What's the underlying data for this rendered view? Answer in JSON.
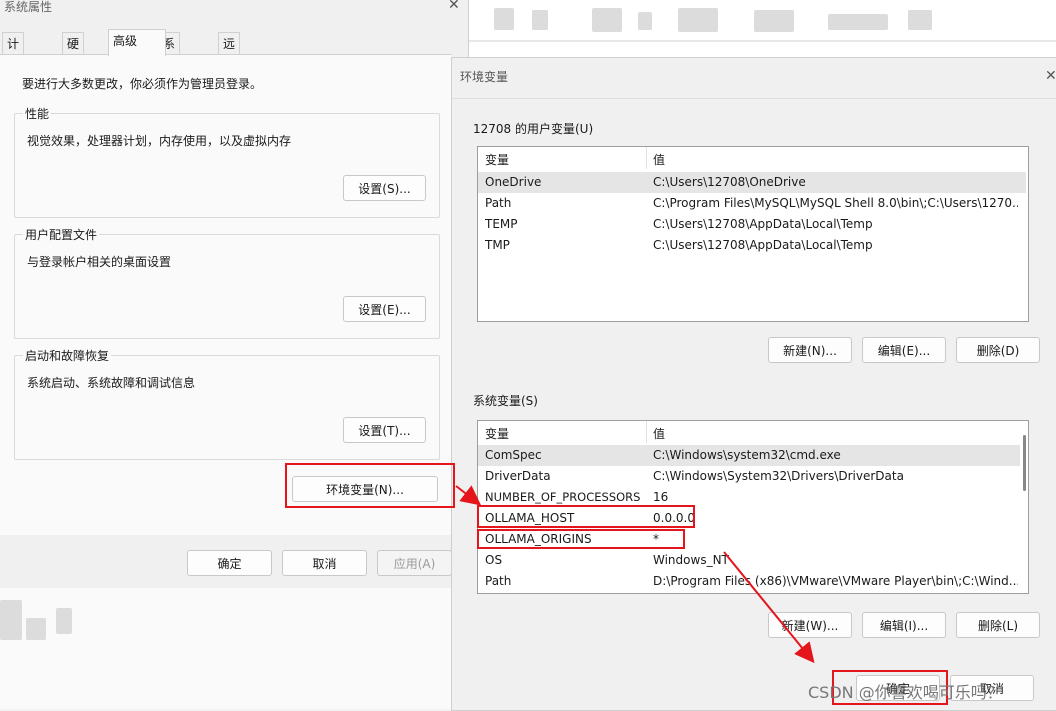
{
  "system_properties": {
    "title": "系统属性",
    "tabs": [
      "计算机名",
      "硬件",
      "高级",
      "系统保护",
      "远程"
    ],
    "active_tab": "高级",
    "admin_note": "要进行大多数更改，你必须作为管理员登录。",
    "performance": {
      "title": "性能",
      "desc": "视觉效果，处理器计划，内存使用，以及虚拟内存",
      "button": "设置(S)..."
    },
    "user_profiles": {
      "title": "用户配置文件",
      "desc": "与登录帐户相关的桌面设置",
      "button": "设置(E)..."
    },
    "startup_recovery": {
      "title": "启动和故障恢复",
      "desc": "系统启动、系统故障和调试信息",
      "button": "设置(T)..."
    },
    "env_button": "环境变量(N)...",
    "ok": "确定",
    "cancel": "取消",
    "apply": "应用(A)"
  },
  "env_dialog": {
    "title": "环境变量",
    "user_vars": {
      "label": "12708 的用户变量(U)",
      "col_name": "变量",
      "col_value": "值",
      "rows": [
        {
          "name": "OneDrive",
          "value": "C:\\Users\\12708\\OneDrive",
          "selected": true
        },
        {
          "name": "Path",
          "value": "C:\\Program Files\\MySQL\\MySQL Shell 8.0\\bin\\;C:\\Users\\1270..."
        },
        {
          "name": "TEMP",
          "value": "C:\\Users\\12708\\AppData\\Local\\Temp"
        },
        {
          "name": "TMP",
          "value": "C:\\Users\\12708\\AppData\\Local\\Temp"
        }
      ],
      "buttons": {
        "new": "新建(N)...",
        "edit": "编辑(E)...",
        "delete": "删除(D)"
      }
    },
    "system_vars": {
      "label": "系统变量(S)",
      "col_name": "变量",
      "col_value": "值",
      "rows": [
        {
          "name": "ComSpec",
          "value": "C:\\Windows\\system32\\cmd.exe",
          "selected": true
        },
        {
          "name": "DriverData",
          "value": "C:\\Windows\\System32\\Drivers\\DriverData"
        },
        {
          "name": "NUMBER_OF_PROCESSORS",
          "value": "16"
        },
        {
          "name": "OLLAMA_HOST",
          "value": "0.0.0.0"
        },
        {
          "name": "OLLAMA_ORIGINS",
          "value": "*"
        },
        {
          "name": "OS",
          "value": "Windows_NT"
        },
        {
          "name": "Path",
          "value": "D:\\Program Files (x86)\\VMware\\VMware Player\\bin\\;C:\\Wind..."
        }
      ],
      "buttons": {
        "new": "新建(W)...",
        "edit": "编辑(I)...",
        "delete": "删除(L)"
      }
    },
    "ok": "确定",
    "cancel": "取消"
  },
  "watermark": "CSDN @你喜欢喝可乐吗？",
  "colors": {
    "annotation_red": "#e5161b",
    "selection": "#e5e5e5",
    "dialog_bg": "#f0f0f0"
  },
  "icons": [
    "close-icon"
  ]
}
